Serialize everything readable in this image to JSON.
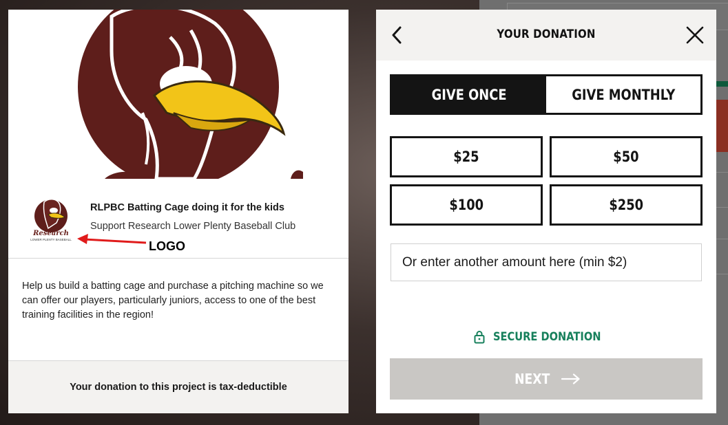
{
  "project": {
    "title": "RLPBC Batting Cage doing it for the kids",
    "subtitle": "Support Research Lower Plenty Baseball Club",
    "logo_text": "Research",
    "logo_subtext": "LOWER PLENTY BASEBALL",
    "annotation_label": "LOGO",
    "description": "Help us build a batting cage and purchase a pitching machine so we can offer our players, particularly juniors, access to one of the best training facilities in the region!",
    "tax_note": "Your donation to this project is tax-deductible"
  },
  "donation": {
    "header_title": "YOUR DONATION",
    "back_icon": "chevron-left-icon",
    "close_icon": "close-icon",
    "frequency_options": [
      {
        "label": "GIVE ONCE",
        "selected": true
      },
      {
        "label": "GIVE MONTHLY",
        "selected": false
      }
    ],
    "amounts": [
      "$25",
      "$50",
      "$100",
      "$250"
    ],
    "custom_amount_placeholder": "Or enter another amount here (min $2)",
    "secure_label": "SECURE DONATION",
    "secure_icon": "lock-icon",
    "next_label": "NEXT",
    "next_icon": "arrow-right-icon"
  },
  "colors": {
    "brand_maroon": "#5e1e1b",
    "accent_green": "#17805c",
    "dark": "#141414",
    "disabled_button": "#c9c7c4",
    "annotation_red": "#e01b1b"
  }
}
